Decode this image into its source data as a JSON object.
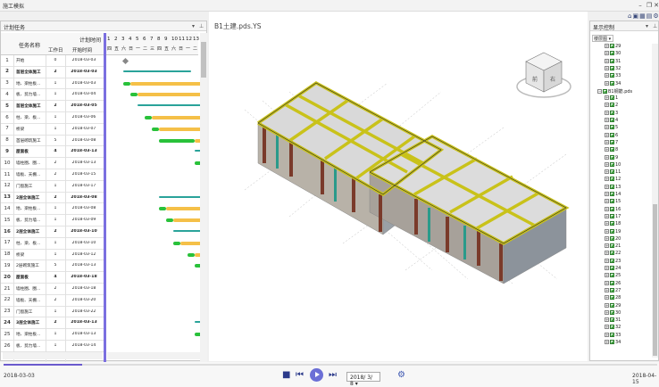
{
  "window": {
    "title": "施工模拟"
  },
  "left_panel": {
    "title": "计划任务",
    "headers": {
      "task_name": "任务名称",
      "plan_time": "计划时间",
      "duration": "工作日",
      "start": "开始时间"
    },
    "rows": [
      {
        "n": "1",
        "name": "开始",
        "dur": "0",
        "start": "2018-03-03",
        "bold": false
      },
      {
        "n": "2",
        "name": "首层全体施工",
        "dur": "2",
        "start": "2018-03-03",
        "bold": true
      },
      {
        "n": "3",
        "name": "地、梁柱板...",
        "dur": "1",
        "start": "2018-03-03",
        "bold": false
      },
      {
        "n": "4",
        "name": "板、剪力墙...",
        "dur": "1",
        "start": "2018-03-04",
        "bold": false
      },
      {
        "n": "5",
        "name": "首层全体施工",
        "dur": "2",
        "start": "2018-03-05",
        "bold": true
      },
      {
        "n": "6",
        "name": "柱、梁、板...",
        "dur": "1",
        "start": "2018-03-06",
        "bold": false
      },
      {
        "n": "7",
        "name": "桥梁",
        "dur": "1",
        "start": "2018-03-07",
        "bold": false
      },
      {
        "n": "8",
        "name": "首层砌筑施工",
        "dur": "5",
        "start": "2018-03-08",
        "bold": false
      },
      {
        "n": "9",
        "name": "屋面板",
        "dur": "4",
        "start": "2018-03-13",
        "bold": true
      },
      {
        "n": "10",
        "name": "墙柱圈、圈...",
        "dur": "2",
        "start": "2018-03-13",
        "bold": false
      },
      {
        "n": "11",
        "name": "墙板、天棚...",
        "dur": "2",
        "start": "2018-03-15",
        "bold": false
      },
      {
        "n": "12",
        "name": "门窗施工",
        "dur": "1",
        "start": "2018-03-17",
        "bold": false
      },
      {
        "n": "13",
        "name": "2层全体施工",
        "dur": "2",
        "start": "2018-03-08",
        "bold": true
      },
      {
        "n": "14",
        "name": "地、梁柱板...",
        "dur": "1",
        "start": "2018-03-08",
        "bold": false
      },
      {
        "n": "15",
        "name": "板、剪力墙...",
        "dur": "1",
        "start": "2018-03-09",
        "bold": false
      },
      {
        "n": "16",
        "name": "2层全体施工",
        "dur": "2",
        "start": "2018-03-10",
        "bold": true
      },
      {
        "n": "17",
        "name": "柱、梁、板...",
        "dur": "1",
        "start": "2018-03-10",
        "bold": false
      },
      {
        "n": "18",
        "name": "桥梁",
        "dur": "1",
        "start": "2018-03-12",
        "bold": false
      },
      {
        "n": "19",
        "name": "2层砌筑施工",
        "dur": "5",
        "start": "2018-03-13",
        "bold": false
      },
      {
        "n": "20",
        "name": "屋面板",
        "dur": "4",
        "start": "2018-03-18",
        "bold": true
      },
      {
        "n": "21",
        "name": "墙柱圈、圈...",
        "dur": "2",
        "start": "2018-03-18",
        "bold": false
      },
      {
        "n": "22",
        "name": "墙板、天棚...",
        "dur": "2",
        "start": "2018-03-20",
        "bold": false
      },
      {
        "n": "23",
        "name": "门窗施工",
        "dur": "1",
        "start": "2018-03-22",
        "bold": false
      },
      {
        "n": "24",
        "name": "3层全体施工",
        "dur": "2",
        "start": "2018-03-13",
        "bold": true
      },
      {
        "n": "25",
        "name": "地、梁柱板...",
        "dur": "1",
        "start": "2018-03-13",
        "bold": false
      },
      {
        "n": "26",
        "name": "板、剪力墙...",
        "dur": "1",
        "start": "2018-03-14",
        "bold": false
      }
    ],
    "gantt_days": [
      "1",
      "2",
      "3",
      "4",
      "5",
      "6",
      "7",
      "8",
      "9",
      "10",
      "11",
      "12",
      "13"
    ],
    "gantt_weekdays": [
      "四",
      "五",
      "六",
      "日",
      "一",
      "二",
      "三",
      "四",
      "五",
      "六",
      "日",
      "一",
      "二"
    ]
  },
  "viewport": {
    "title": "B1土建.pds.YS"
  },
  "viewcube": {
    "left_face": "前",
    "right_face": "右"
  },
  "right_panel": {
    "title": "显示控制",
    "dropdown": "楼层图",
    "items": [
      {
        "label": "29",
        "level": 2
      },
      {
        "label": "30",
        "level": 2
      },
      {
        "label": "31",
        "level": 2
      },
      {
        "label": "32",
        "level": 2
      },
      {
        "label": "33",
        "level": 2
      },
      {
        "label": "34",
        "level": 2
      },
      {
        "label": "B1钢筋.pds",
        "level": 1
      },
      {
        "label": "1",
        "level": 2
      },
      {
        "label": "2",
        "level": 2
      },
      {
        "label": "3",
        "level": 2
      },
      {
        "label": "4",
        "level": 2
      },
      {
        "label": "5",
        "level": 2
      },
      {
        "label": "6",
        "level": 2
      },
      {
        "label": "7",
        "level": 2
      },
      {
        "label": "8",
        "level": 2
      },
      {
        "label": "9",
        "level": 2
      },
      {
        "label": "10",
        "level": 2
      },
      {
        "label": "11",
        "level": 2
      },
      {
        "label": "12",
        "level": 2
      },
      {
        "label": "13",
        "level": 2
      },
      {
        "label": "14",
        "level": 2
      },
      {
        "label": "15",
        "level": 2
      },
      {
        "label": "16",
        "level": 2
      },
      {
        "label": "17",
        "level": 2
      },
      {
        "label": "18",
        "level": 2
      },
      {
        "label": "19",
        "level": 2
      },
      {
        "label": "20",
        "level": 2
      },
      {
        "label": "21",
        "level": 2
      },
      {
        "label": "22",
        "level": 2
      },
      {
        "label": "23",
        "level": 2
      },
      {
        "label": "24",
        "level": 2
      },
      {
        "label": "25",
        "level": 2
      },
      {
        "label": "26",
        "level": 2
      },
      {
        "label": "27",
        "level": 2
      },
      {
        "label": "28",
        "level": 2
      },
      {
        "label": "29",
        "level": 2
      },
      {
        "label": "30",
        "level": 2
      },
      {
        "label": "31",
        "level": 2
      },
      {
        "label": "32",
        "level": 2
      },
      {
        "label": "33",
        "level": 2
      },
      {
        "label": "34",
        "level": 2
      }
    ]
  },
  "playback": {
    "start_date": "2018-03-03",
    "end_date": "2018-04-15",
    "current_date": "2018/ 3/ 8",
    "progress": 0.12
  },
  "colors": {
    "summary_bar": "#2aa39a",
    "done_bar": "#29c13a",
    "remain_bar": "#f5c048",
    "milestone": "#6a5acd",
    "beam": "#c9c21a"
  }
}
